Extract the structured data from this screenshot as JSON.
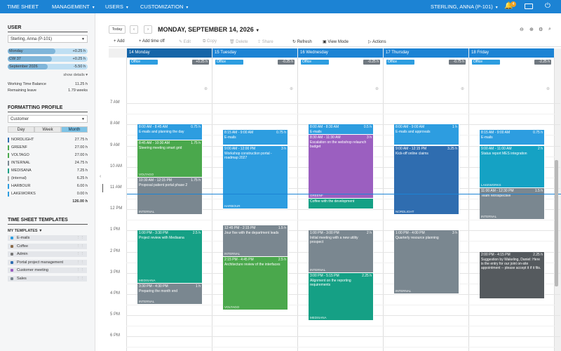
{
  "topnav": {
    "items": [
      "TIME SHEET",
      "MANAGEMENT",
      "USERS",
      "CUSTOMIZATION"
    ],
    "user": "STERLING, ANNA (P-101)",
    "badge": "4"
  },
  "sidebar": {
    "user_title": "USER",
    "user_select": "Sterling, Anna (P-101)",
    "periods": [
      {
        "label": "Monday",
        "value": "+0.25 h",
        "fill": 0.6
      },
      {
        "label": "CW 37",
        "value": "+0.25 h",
        "fill": 0.55
      },
      {
        "label": "September 2026",
        "value": "-5.50 h",
        "fill": 0.5
      }
    ],
    "show_details": "show details",
    "balance_label": "Working Time Balance",
    "balance_value": "11.25 h",
    "leave_label": "Remaining leave",
    "leave_value": "1.79 weeks",
    "profile_title": "FORMATTING PROFILE",
    "profile_select": "Customer",
    "segments": [
      "Day",
      "Week",
      "Month"
    ],
    "profile_rows": [
      {
        "label": "NORDLIGHT",
        "value": "27.75 h",
        "color": "#2f6db0"
      },
      {
        "label": "GREENF",
        "value": "27.00 h",
        "color": "#4aa84c"
      },
      {
        "label": "VOLTAGO",
        "value": "27.00 h",
        "color": "#4aa84c"
      },
      {
        "label": "INTERNAL",
        "value": "24.75 h",
        "color": "#7a8790"
      },
      {
        "label": "MEDISANA",
        "value": "7.25 h",
        "color": "#15a085"
      },
      {
        "label": "(internal)",
        "value": "6.25 h",
        "color": "#aaaaaa"
      },
      {
        "label": "HARBOUR",
        "value": "6.00 h",
        "color": "#2d9de0"
      },
      {
        "label": "LAKEWORKS",
        "value": "0.00 h",
        "color": "#2d9de0"
      }
    ],
    "profile_total": "126.00 h",
    "templates_title": "TIME SHEET TEMPLATES",
    "my_templates": "MY TEMPLATES",
    "templates": [
      {
        "label": "E-mails",
        "color": "#2d9de0"
      },
      {
        "label": "Coffee",
        "color": "#8a6b4a"
      },
      {
        "label": "Admin",
        "color": "#777777"
      },
      {
        "label": "Portal project management",
        "color": "#2f6db0"
      },
      {
        "label": "Customer meeting",
        "color": "#9b5fc0"
      },
      {
        "label": "Sales",
        "color": "#7a8790"
      }
    ]
  },
  "toolbar": {
    "today": "Today",
    "date": "MONDAY, SEPTEMBER 14, 2026",
    "add": "Add",
    "add_time_off": "Add time off",
    "edit": "Edit",
    "copy": "Copy",
    "delete": "Delete",
    "share": "Share",
    "refresh": "Refresh",
    "view_mode": "View Mode",
    "actions": "Actions"
  },
  "days": [
    {
      "label": "14 Monday",
      "office": "Office",
      "office_value": "+0.25 h"
    },
    {
      "label": "15 Tuesday",
      "office": "Office",
      "office_value": "-0.25 h"
    },
    {
      "label": "16 Wednesday",
      "office": "Office",
      "office_value": "-0.25 h"
    },
    {
      "label": "17 Thursday",
      "office": "Office",
      "office_value": "-0.75 h"
    },
    {
      "label": "18 Friday",
      "office": "Office",
      "office_value": "-2.25 h"
    }
  ],
  "hours": [
    "7 AM",
    "8 AM",
    "9 AM",
    "10 AM",
    "11 AM",
    "12 PM",
    "1 PM",
    "2 PM",
    "3 PM",
    "4 PM",
    "5 PM",
    "6 PM"
  ],
  "events": [
    {
      "day": 0,
      "start": 8,
      "end": 8.75,
      "time": "8:00 AM - 8:45 AM",
      "dur": "0.75 h",
      "text": "E-mails and planning the day",
      "footer": "",
      "color": "#2d9de0"
    },
    {
      "day": 0,
      "start": 8.75,
      "end": 10.5,
      "time": "8:45 AM - 10:30 AM",
      "dur": "1.75 h",
      "text": "Steering meeting smart grid",
      "footer": "VOLTAGO",
      "color": "#4aa84c"
    },
    {
      "day": 0,
      "start": 10.5,
      "end": 12.25,
      "time": "10:30 AM - 12:15 PM",
      "dur": "1.75 h",
      "text": "Proposal patient portal phase 2",
      "footer": "INTERNAL",
      "color": "#7a8790"
    },
    {
      "day": 0,
      "start": 13,
      "end": 15.5,
      "time": "1:00 PM - 3:30 PM",
      "dur": "2.5 h",
      "text": "Project review with Medisana",
      "footer": "MEDISANA",
      "color": "#15a085"
    },
    {
      "day": 0,
      "start": 15.5,
      "end": 16.5,
      "time": "3:30 PM - 4:30 PM",
      "dur": "1 h",
      "text": "Preparing the month end",
      "footer": "INTERNAL",
      "color": "#7a8790"
    },
    {
      "day": 1,
      "start": 8.25,
      "end": 9,
      "time": "8:15 AM - 9:00 AM",
      "dur": "0.75 h",
      "text": "E-mails",
      "footer": "",
      "color": "#2d9de0"
    },
    {
      "day": 1,
      "start": 9,
      "end": 12,
      "time": "9:00 AM - 12:00 PM",
      "dur": "3 h",
      "text": "Workshop construction portal - roadmap 2027",
      "footer": "HARBOUR",
      "color": "#2d9de0"
    },
    {
      "day": 1,
      "start": 12.75,
      "end": 14.25,
      "time": "12:45 PM - 2:15 PM",
      "dur": "1.5 h",
      "text": "Jour fixe with the department leads",
      "footer": "INTERNAL",
      "color": "#7a8790"
    },
    {
      "day": 1,
      "start": 14.25,
      "end": 16.75,
      "time": "2:15 PM - 4:45 PM",
      "dur": "2.5 h",
      "text": "Architecture review of the interfaces",
      "footer": "VOLTAGO",
      "color": "#4aa84c"
    },
    {
      "day": 2,
      "start": 8,
      "end": 8.5,
      "time": "8:00 AM - 8:30 AM",
      "dur": "0.5 h",
      "text": "E-mails",
      "footer": "",
      "color": "#2d9de0"
    },
    {
      "day": 2,
      "start": 8.5,
      "end": 11.5,
      "time": "8:30 AM - 11:30 AM",
      "dur": "3 h",
      "text": "Escalation on the webshop relaunch budget",
      "footer": "GREENF",
      "color": "#9b5fc0"
    },
    {
      "day": 2,
      "start": 11.5,
      "end": 12,
      "time": "",
      "dur": "",
      "text": "Coffee with the development",
      "footer": "",
      "color": "#15a085"
    },
    {
      "day": 2,
      "start": 13,
      "end": 15,
      "time": "1:00 PM - 3:00 PM",
      "dur": "2 h",
      "text": "Initial meeting with a new utility prospect",
      "footer": "INTERNAL",
      "color": "#7a8790"
    },
    {
      "day": 2,
      "start": 15,
      "end": 17.25,
      "time": "3:00 PM - 5:15 PM",
      "dur": "2.25 h",
      "text": "Alignment on the reporting requirements",
      "footer": "MEDISANA",
      "color": "#15a085"
    },
    {
      "day": 3,
      "start": 8,
      "end": 9,
      "time": "8:00 AM - 9:00 AM",
      "dur": "1 h",
      "text": "E-mails and approvals",
      "footer": "",
      "color": "#2d9de0"
    },
    {
      "day": 3,
      "start": 9,
      "end": 12.25,
      "time": "9:00 AM - 12:15 PM",
      "dur": "3.25 h",
      "text": "Kick-off online claims",
      "footer": "NORDLIGHT",
      "color": "#2f6db0"
    },
    {
      "day": 3,
      "start": 13,
      "end": 16,
      "time": "1:00 PM - 4:00 PM",
      "dur": "3 h",
      "text": "Quarterly resource planning",
      "footer": "INTERNAL",
      "color": "#7a8790"
    },
    {
      "day": 4,
      "start": 8.25,
      "end": 9,
      "time": "8:15 AM - 9:00 AM",
      "dur": "0.75 h",
      "text": "E-mails",
      "footer": "",
      "color": "#2d9de0"
    },
    {
      "day": 4,
      "start": 9,
      "end": 11,
      "time": "9:00 AM - 11:00 AM",
      "dur": "2 h",
      "text": "Status report MES integration",
      "footer": "LAKEWORKS",
      "color": "#15a2c4"
    },
    {
      "day": 4,
      "start": 11,
      "end": 12.5,
      "time": "11:00 AM - 12:30 PM",
      "dur": "1.5 h",
      "text": "Team retrospective",
      "footer": "INTERNAL",
      "color": "#7a8790"
    },
    {
      "day": 4,
      "start": 14,
      "end": 16.25,
      "time": "2:00 PM - 4:15 PM",
      "dur": "2.25 h",
      "text": "Suggestion by Wakeling, Daniel: Here is the entry for our joint on-site appointment -- please accept it if it fits.",
      "footer": "",
      "color": "#555a5e"
    }
  ]
}
